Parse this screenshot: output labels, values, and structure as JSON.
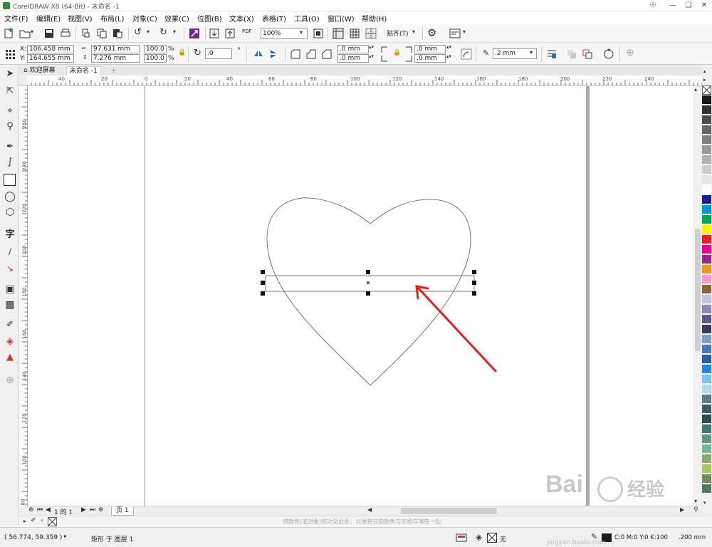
{
  "window": {
    "title": "CorelDRAW X8 (64-Bit) - 未命名 -1"
  },
  "menu": [
    "文件(F)",
    "编辑(E)",
    "视图(V)",
    "布局(L)",
    "对象(C)",
    "效果(C)",
    "位图(B)",
    "文本(X)",
    "表格(T)",
    "工具(O)",
    "窗口(W)",
    "帮助(H)"
  ],
  "toolbar": {
    "zoom_value": "100%",
    "pdf_label": "PDF",
    "snap_label": "贴齐(T)"
  },
  "property_bar": {
    "x_label": "X:",
    "x_value": "106.458 mm",
    "y_label": "Y:",
    "y_value": "164.655 mm",
    "width_value": "97.631 mm",
    "height_value": "7.276 mm",
    "scale_x": "100.0",
    "scale_y": "100.0",
    "percent": "%",
    "rotation": ".0",
    "corner_tl": ".0 mm",
    "corner_bl": ".0 mm",
    "corner_tr": ".0 mm",
    "corner_br": ".0 mm",
    "outline_width": ".2 mm"
  },
  "tabs": {
    "welcome": "欢迎屏幕",
    "document": "未命名 -1"
  },
  "ruler_h": [
    "40",
    "20",
    "0",
    "20",
    "40",
    "60",
    "80",
    "100",
    "120",
    "140",
    "160",
    "180",
    "200",
    "220",
    "240"
  ],
  "ruler_v": [
    "260",
    "240",
    "220",
    "200",
    "180",
    "160",
    "140",
    "120",
    "100",
    "80"
  ],
  "page_nav": {
    "count": "1 的 1",
    "page_tab": "页 1"
  },
  "docpal_hint": "将颜色(或对象)拖动至此处，以便将这些颜色与文档存储在一起",
  "status": {
    "coords": "( 56.774, 59.359 )",
    "selection": "矩形 于 图层 1",
    "fill": "无",
    "outline_color": "C:0 M:0 Y:0 K:100",
    "outline_width": ".200 mm"
  },
  "watermark": {
    "line1": "Bai",
    "line2": "经验",
    "url": "jingyan.baidu.com"
  },
  "palette_colors": [
    "#1a1a1a",
    "#333333",
    "#4d4d4d",
    "#666666",
    "#808080",
    "#999999",
    "#b3b3b3",
    "#cccccc",
    "#e6e6e6",
    "#ffffff",
    "#1c1f8f",
    "#0096d6",
    "#00a651",
    "#fff200",
    "#ed1c24",
    "#ec008c",
    "#a3238e",
    "#f7941d",
    "#f49ac1",
    "#8c6239",
    "#c6c2e0",
    "#8b88b8",
    "#5b5a86",
    "#3c3b5c",
    "#7f9fc2",
    "#4a78b5",
    "#2b5ea0",
    "#1e88e5",
    "#7dc0ea",
    "#b4d8ec",
    "#5f7d87",
    "#3f5f66",
    "#2e4c50",
    "#417a6d",
    "#5e9b83",
    "#79b597",
    "#8aa86d",
    "#a7c957",
    "#6d8f57",
    "#4f7b58"
  ]
}
